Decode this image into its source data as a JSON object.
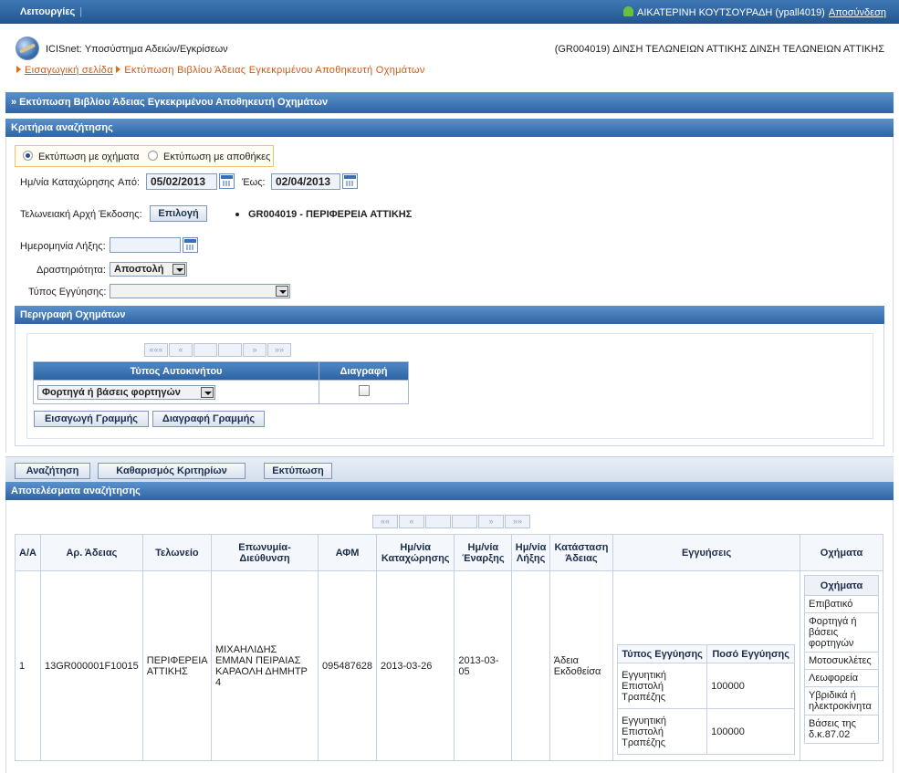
{
  "topbar": {
    "menu_label": "Λειτουργίες",
    "separator": "|",
    "user_name": "ΑΙΚΑΤΕΡΙΝΗ ΚΟΥΤΣΟΥΡΑΔΗ (ypall4019)",
    "logout": "Αποσύνδεση"
  },
  "header": {
    "app_name": "ICISnet: Υποσύστημα Αδειών/Εγκρίσεων",
    "office": "(GR004019) ΔΙΝΣΗ ΤΕΛΩΝΕΙΩΝ ΑΤΤΙΚΗΣ ΔΙΝΣΗ ΤΕΛΩΝΕΙΩΝ ΑΤΤΙΚΗΣ",
    "breadcrumb_home": "Εισαγωγική σελίδα",
    "breadcrumb_current": "Εκτύπωση Βιβλίου Άδειας Εγκεκριμένου Αποθηκευτή Οχημάτων"
  },
  "page_title": "» Εκτύπωση Βιβλίου Άδειας Εγκεκριμένου Αποθηκευτή Οχημάτων",
  "criteria": {
    "section_title": "Κριτήρια αναζήτησης",
    "radio_vehicles": "Εκτύπωση με οχήματα",
    "radio_warehouses": "Εκτύπωση με αποθήκες",
    "date_label": "Ημ/νία Καταχώρησης",
    "from_label": "Από:",
    "from_value": "05/02/2013",
    "to_label": "Έως:",
    "to_value": "02/04/2013",
    "customs_label": "Τελωνειακή Αρχή Έκδοσης:",
    "select_button": "Επιλογή",
    "selected_office": "GR004019 - ΠΕΡΙΦΕΡΕΙΑ ΑΤΤΙΚΗΣ",
    "expiry_label": "Ημερομηνία Λήξης:",
    "expiry_value": "",
    "activity_label": "Δραστηριότητα:",
    "activity_value": "Αποστολή",
    "guarantee_label": "Τύπος Εγγύησης:",
    "guarantee_value": ""
  },
  "vehicles": {
    "section_title": "Περιγραφή Οχημάτων",
    "pager": [
      "«««",
      "«",
      "",
      "",
      "»",
      "»»"
    ],
    "col_type": "Τύπος Αυτοκινήτου",
    "col_delete": "Διαγραφή",
    "row_type_value": "Φορτηγά ή βάσεις φορτηγών",
    "add_row": "Εισαγωγή Γραμμής",
    "delete_row": "Διαγραφή Γραμμής"
  },
  "actions": {
    "search": "Αναζήτηση",
    "clear": "Καθαρισμός Κριτηρίων",
    "print": "Εκτύπωση"
  },
  "results": {
    "section_title": "Αποτελέσματα αναζήτησης",
    "pager": [
      "««",
      "«",
      "",
      "",
      "»",
      "»»"
    ],
    "columns": [
      "Α/Α",
      "Αρ. Άδειας",
      "Τελωνείο",
      "Επωνυμία-Διεύθυνση",
      "ΑΦΜ",
      "Ημ/νία Καταχώρησης",
      "Ημ/νία Έναρξης",
      "Ημ/νία Λήξης",
      "Κατάσταση Άδειας",
      "Εγγυήσεις",
      "Οχήματα"
    ],
    "row": {
      "aa": "1",
      "license": "13GR000001F10015",
      "customs": "ΠΕΡΙΦΕΡΕΙΑ ΑΤΤΙΚΗΣ",
      "name_address": "ΜΙΧΑΗΛΙΔΗΣ ΕΜΜΑΝ ΠΕΙΡΑΙΑΣ ΚΑΡΑΟΛΗ ΔΗΜΗΤΡ 4",
      "afm": "095487628",
      "registration": "2013-03-26",
      "start": "2013-03-05",
      "expiry": "",
      "status": "Άδεια Εκδοθείσα"
    },
    "guarantees": {
      "col_type": "Τύπος Εγγύησης",
      "col_amount": "Ποσό Εγγύησης",
      "rows": [
        {
          "type": "Εγγυητική Επιστολή Τραπέζης",
          "amount": "100000"
        },
        {
          "type": "Εγγυητική Επιστολή Τραπέζης",
          "amount": "100000"
        }
      ]
    },
    "vehicles_list": {
      "header": "Οχήματα",
      "items": [
        "Επιβατικό",
        "Φορτηγά ή βάσεις φορτηγών",
        "Μοτοσυκλέτες",
        "Λεωφορεία",
        "Υβριδικά ή ηλεκτροκίνητα",
        "Βάσεις της δ.κ.87.02"
      ]
    }
  }
}
